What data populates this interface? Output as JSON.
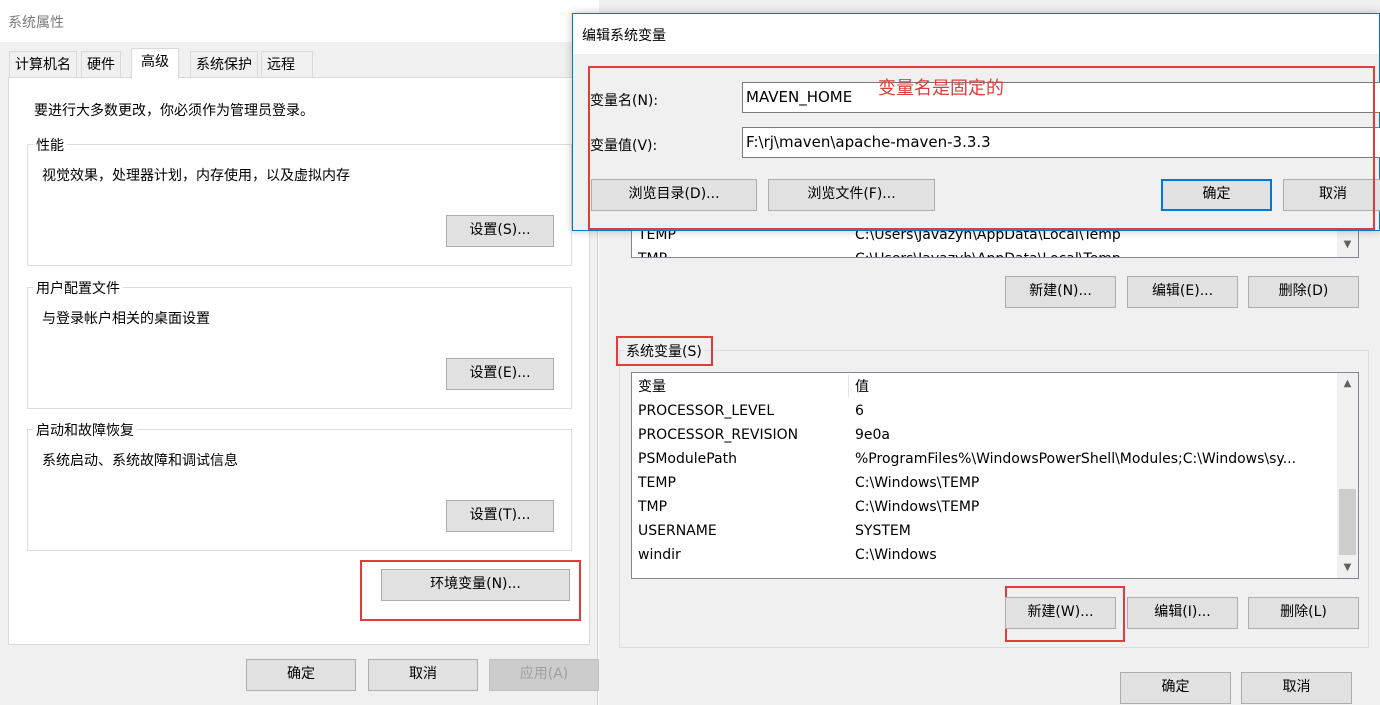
{
  "system_properties": {
    "window_title": "系统属性",
    "tabs": [
      {
        "label": "计算机名"
      },
      {
        "label": "硬件"
      },
      {
        "label": "高级"
      },
      {
        "label": "系统保护"
      },
      {
        "label": "远程"
      }
    ],
    "active_tab": "高级",
    "admin_notice": "要进行大多数更改，你必须作为管理员登录。",
    "performance": {
      "title": "性能",
      "description": "视觉效果，处理器计划，内存使用，以及虚拟内存",
      "button": "设置(S)..."
    },
    "user_profiles": {
      "title": "用户配置文件",
      "description": "与登录帐户相关的桌面设置",
      "button": "设置(E)..."
    },
    "startup_recovery": {
      "title": "启动和故障恢复",
      "description": "系统启动、系统故障和调试信息",
      "button": "设置(T)..."
    },
    "env_button": "环境变量(N)...",
    "ok": "确定",
    "cancel": "取消",
    "apply": "应用(A)"
  },
  "environment_variables": {
    "user_vars_partial": [
      {
        "name": "TEMP",
        "value": "C:\\Users\\Javazyh\\AppData\\Local\\Temp"
      },
      {
        "name": "TMP",
        "value": "C:\\Users\\Javazyh\\AppData\\Local\\Temp"
      }
    ],
    "user_buttons": {
      "new": "新建(N)...",
      "edit": "编辑(E)...",
      "delete": "删除(D)"
    },
    "system_section_title": "系统变量(S)",
    "columns": {
      "name": "变量",
      "value": "值"
    },
    "system_vars": [
      {
        "name": "PROCESSOR_LEVEL",
        "value": "6"
      },
      {
        "name": "PROCESSOR_REVISION",
        "value": "9e0a"
      },
      {
        "name": "PSModulePath",
        "value": "%ProgramFiles%\\WindowsPowerShell\\Modules;C:\\Windows\\sy..."
      },
      {
        "name": "TEMP",
        "value": "C:\\Windows\\TEMP"
      },
      {
        "name": "TMP",
        "value": "C:\\Windows\\TEMP"
      },
      {
        "name": "USERNAME",
        "value": "SYSTEM"
      },
      {
        "name": "windir",
        "value": "C:\\Windows"
      }
    ],
    "system_buttons": {
      "new": "新建(W)...",
      "edit": "编辑(I)...",
      "delete": "删除(L)"
    },
    "ok": "确定",
    "cancel": "取消"
  },
  "edit_dialog": {
    "title": "编辑系统变量",
    "name_label": "变量名(N):",
    "name_value": "MAVEN_HOME",
    "value_label": "变量值(V):",
    "value_value": "F:\\rj\\maven\\apache-maven-3.3.3",
    "browse_dir": "浏览目录(D)...",
    "browse_file": "浏览文件(F)...",
    "ok": "确定",
    "cancel": "取消",
    "annotation": "变量名是固定的"
  },
  "colors": {
    "highlight_box": "#e03c3c",
    "dialog_border": "#0078d7",
    "window_bg": "#f0f0f0"
  }
}
